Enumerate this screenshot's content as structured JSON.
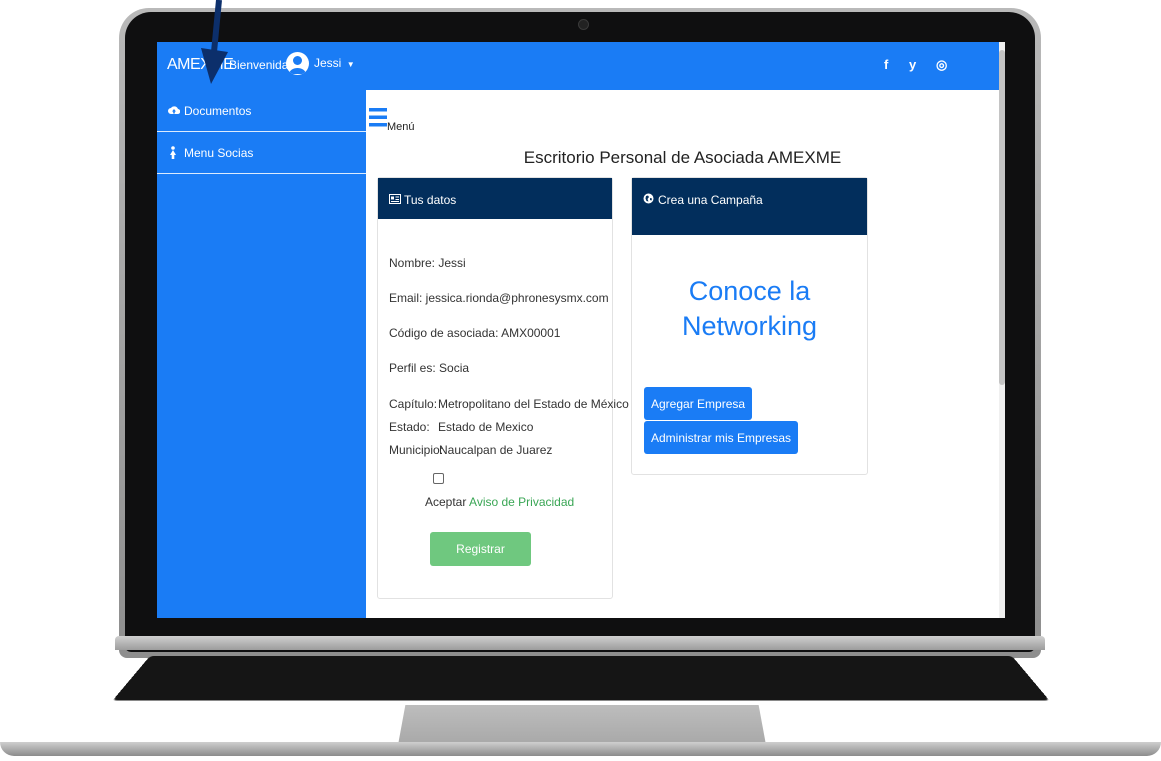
{
  "navbar": {
    "brand": "AMEXME",
    "welcome_label": "Bienvenida:",
    "user_name": "Jessi",
    "social": [
      "f",
      "y",
      "◎"
    ]
  },
  "sidebar": {
    "items": [
      {
        "label": "Documentos",
        "icon": "cloud-upload-icon"
      },
      {
        "label": "Menu Socias",
        "icon": "female-user-icon"
      }
    ]
  },
  "main": {
    "menu_label": "Menú",
    "page_title": "Escritorio Personal de Asociada AMEXME"
  },
  "datos_card": {
    "header": "Tus datos",
    "nombre": "Nombre: Jessi",
    "email": "Email: jessica.rionda@phronesysmx.com",
    "codigo": "Código de asociada: AMX00001",
    "perfil": "Perfil es: Socia",
    "capitulo_label": "Capítulo:",
    "capitulo_value": "Metropolitano del Estado de México",
    "estado_label": "Estado:",
    "estado_value": "Estado de Mexico",
    "municipio_label": "Municipio:",
    "municipio_value": "Naucalpan de Juarez",
    "accept_text": "Aceptar",
    "privacy_link": "Aviso de Privacidad",
    "register_button": "Registrar"
  },
  "campaign_card": {
    "header": "Crea una Campaña",
    "promo_line1": "Conoce la",
    "promo_line2": "Networking",
    "add_company_button": "Agregar Empresa",
    "manage_companies_button": "Administrar mis Empresas"
  },
  "colors": {
    "primary": "#1a7cf5",
    "card_header": "#022e5c",
    "register_button": "#6fc87f",
    "privacy_link": "#3aa655",
    "arrow": "#0c2f6b"
  }
}
